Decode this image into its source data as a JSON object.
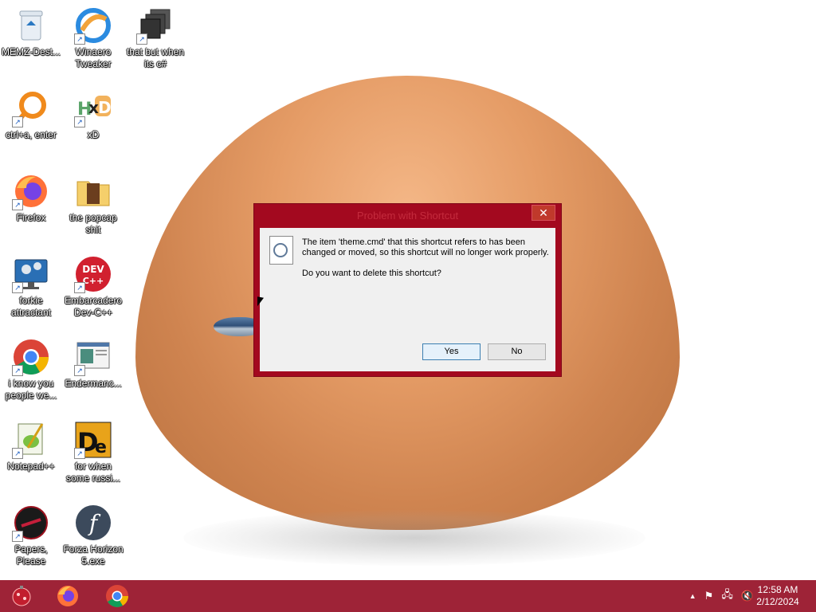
{
  "desktop": {
    "icons": [
      {
        "label": "MEMZ-Dest...",
        "icon": "recycle-bin-icon"
      },
      {
        "label": "Winaero\nTweaker",
        "icon": "winaero-icon"
      },
      {
        "label": "that but when\nits c#",
        "icon": "stacked-windows-icon"
      },
      {
        "label": "ctrl+a, enter",
        "icon": "magnifier-icon"
      },
      {
        "label": "xD",
        "icon": "hxd-icon"
      },
      {
        "label": "Firefox",
        "icon": "firefox-icon"
      },
      {
        "label": "the popcap\nshit",
        "icon": "folder-icon"
      },
      {
        "label": "forkie\nattractant",
        "icon": "settings-monitor-icon"
      },
      {
        "label": "Embarcadero\nDev-C++",
        "icon": "devcpp-icon"
      },
      {
        "label": "i know you\npeople we...",
        "icon": "chrome-icon"
      },
      {
        "label": "Endermanc...",
        "icon": "window-app-icon"
      },
      {
        "label": "Notepad++",
        "icon": "notepadpp-icon"
      },
      {
        "label": "for when\nsome russi...",
        "icon": "de-icon"
      },
      {
        "label": "Papers, Please",
        "icon": "papers-please-icon"
      },
      {
        "label": "Forza Horizon\n5.exe",
        "icon": "flash-icon"
      }
    ]
  },
  "dialog": {
    "title": "Problem with Shortcut",
    "close": "✕",
    "message": "The item 'theme.cmd' that this shortcut refers to has been changed or moved, so this shortcut will no longer work properly.",
    "question": "Do you want to delete this shortcut?",
    "yes_label": "Yes",
    "no_label": "No"
  },
  "taskbar": {
    "apps": [
      "start-ornament-icon",
      "firefox-icon",
      "chrome-icon"
    ],
    "tray": {
      "chevron": "▲",
      "flag": "⚑",
      "network": "🖧",
      "volume": "🔇"
    },
    "time": "12:58 AM",
    "date": "2/12/2024"
  },
  "colors": {
    "taskbar": "#9e2337",
    "dialog_frame": "#a3091f"
  }
}
